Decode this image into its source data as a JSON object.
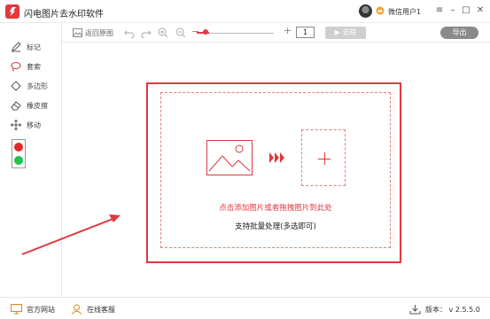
{
  "window": {
    "title": "闪电图片去水印软件",
    "username": "微信用户1",
    "minimize_icon": "minimize-icon",
    "maximize_icon": "maximize-icon",
    "close_icon": "close-icon"
  },
  "toolbar": {
    "back_label": "返回原图",
    "page_value": "1",
    "remove_label": "▶ 去除",
    "export_label": "导出"
  },
  "tools": [
    {
      "label": "标记",
      "icon": "pen-icon"
    },
    {
      "label": "套索",
      "icon": "lasso-icon"
    },
    {
      "label": "多边形",
      "icon": "polygon-icon"
    },
    {
      "label": "橡皮擦",
      "icon": "eraser-icon"
    },
    {
      "label": "移动",
      "icon": "move-icon"
    }
  ],
  "canvas": {
    "hint_main": "点击添加图片或者拖拽图片到此处",
    "hint_sub": "支持批量处理(多选即可)"
  },
  "footer": {
    "website": "官方网站",
    "support": "在线客服",
    "version": "版本： v 2.5.5.0"
  },
  "colors": {
    "accent": "#e0393e",
    "light_red": "#e02a2a",
    "light_green": "#1fc24a"
  }
}
